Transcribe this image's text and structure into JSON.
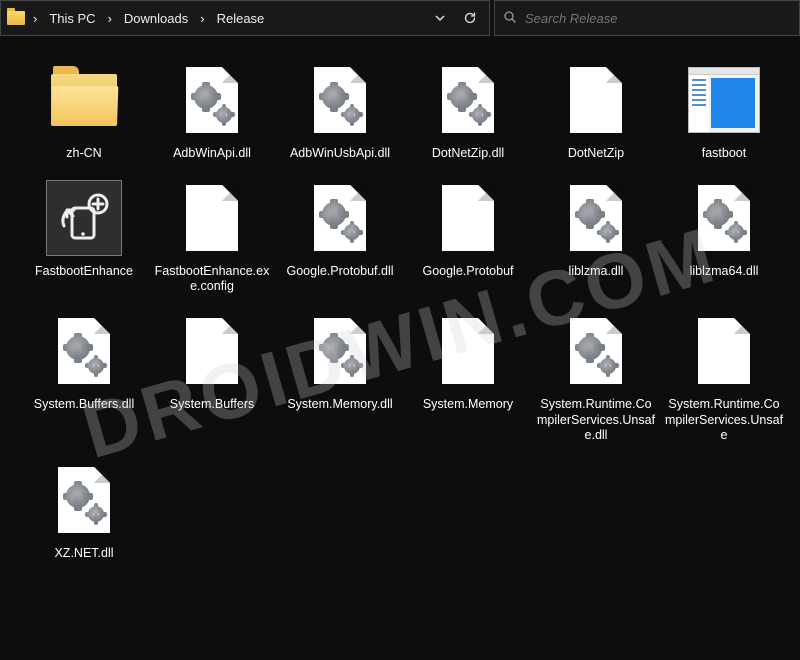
{
  "breadcrumb": {
    "segments": [
      "This PC",
      "Downloads",
      "Release"
    ]
  },
  "search": {
    "placeholder": "Search Release"
  },
  "watermark": "DROIDWIN.COM",
  "items": [
    {
      "name": "zh-CN",
      "kind": "folder"
    },
    {
      "name": "AdbWinApi.dll",
      "kind": "file-gears"
    },
    {
      "name": "AdbWinUsbApi.dll",
      "kind": "file-gears"
    },
    {
      "name": "DotNetZip.dll",
      "kind": "file-gears"
    },
    {
      "name": "DotNetZip",
      "kind": "file-blank"
    },
    {
      "name": "fastboot",
      "kind": "textfile"
    },
    {
      "name": "FastbootEnhance",
      "kind": "app-icon"
    },
    {
      "name": "FastbootEnhance.exe.config",
      "kind": "file-blank"
    },
    {
      "name": "Google.Protobuf.dll",
      "kind": "file-gears"
    },
    {
      "name": "Google.Protobuf",
      "kind": "file-blank"
    },
    {
      "name": "liblzma.dll",
      "kind": "file-gears"
    },
    {
      "name": "liblzma64.dll",
      "kind": "file-gears"
    },
    {
      "name": "System.Buffers.dll",
      "kind": "file-gears"
    },
    {
      "name": "System.Buffers",
      "kind": "file-blank"
    },
    {
      "name": "System.Memory.dll",
      "kind": "file-gears"
    },
    {
      "name": "System.Memory",
      "kind": "file-blank"
    },
    {
      "name": "System.Runtime.CompilerServices.Unsafe.dll",
      "kind": "file-gears"
    },
    {
      "name": "System.Runtime.CompilerServices.Unsafe",
      "kind": "file-blank"
    },
    {
      "name": "XZ.NET.dll",
      "kind": "file-gears"
    }
  ]
}
